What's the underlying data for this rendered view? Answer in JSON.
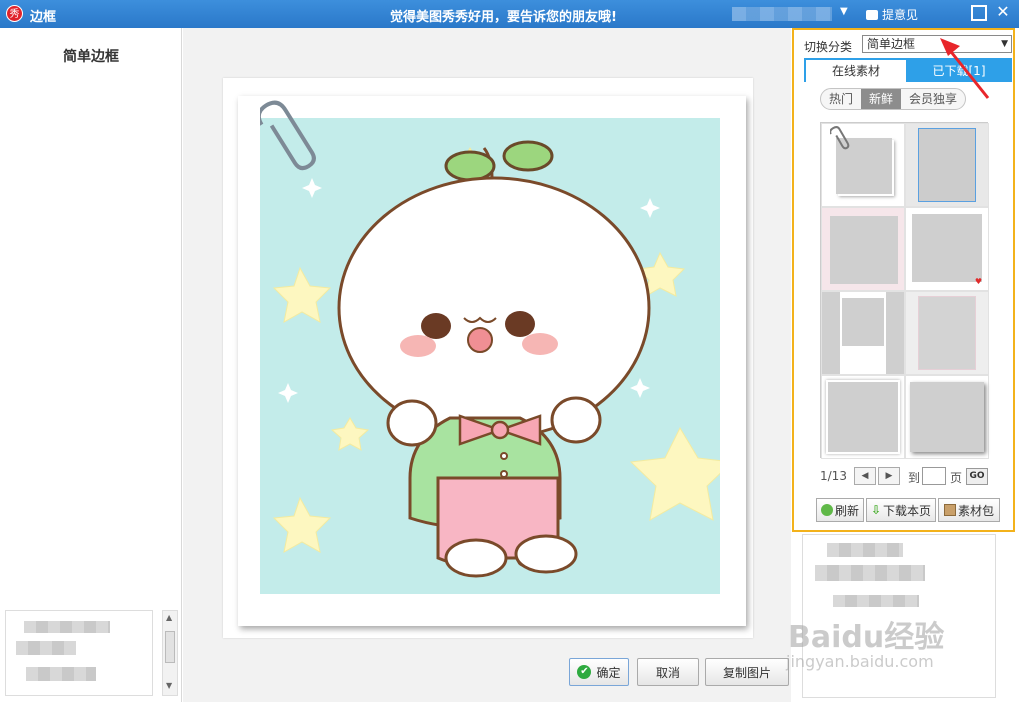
{
  "titlebar": {
    "logo_text": "秀",
    "title": "边框",
    "slogan": "觉得美图秀秀好用，要告诉您的朋友哦!",
    "dropdown_glyph": "▼",
    "feedback_label": "提意见",
    "close_glyph": "✕"
  },
  "left_panel": {
    "title": "简单边框",
    "scroll_up_glyph": "▲",
    "scroll_down_glyph": "▼"
  },
  "canvas": {
    "ok_label": "确定",
    "ok_glyph": "✔",
    "cancel_label": "取消",
    "copy_label": "复制图片"
  },
  "material": {
    "switch_label": "切换分类",
    "category_value": "简单边框",
    "category_dd_glyph": "▼",
    "tabs": {
      "online": "在线素材",
      "downloaded": "已下载[1]"
    },
    "sub_tabs": [
      "热门",
      "新鲜",
      "会员独享"
    ],
    "active_sub_tab": "新鲜",
    "pager": {
      "page_text": "1/13",
      "prev_glyph": "◀",
      "next_glyph": "▶",
      "to_label": "到",
      "page_label": "页",
      "go_label": "GO"
    },
    "actions": {
      "refresh": "刷新",
      "download": "下载本页",
      "pack": "素材包"
    }
  },
  "watermark": {
    "main": "Baidu经验",
    "sub": "jingyan.baidu.com"
  },
  "colors": {
    "titlebar": "#2a78c9",
    "highlight_border": "#f3b21b",
    "tab_blue": "#2ea0e8",
    "ok_green": "#2eaa3f",
    "annotation_arrow": "#e8262b"
  }
}
